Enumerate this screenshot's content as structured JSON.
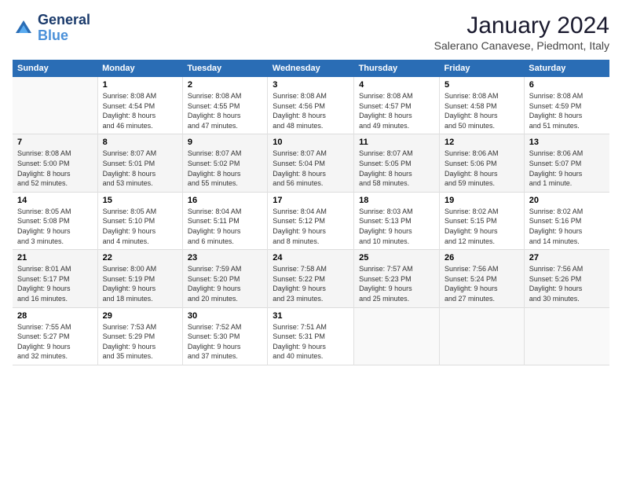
{
  "logo": {
    "line1": "General",
    "line2": "Blue"
  },
  "title": "January 2024",
  "location": "Salerano Canavese, Piedmont, Italy",
  "days_header": [
    "Sunday",
    "Monday",
    "Tuesday",
    "Wednesday",
    "Thursday",
    "Friday",
    "Saturday"
  ],
  "weeks": [
    [
      {
        "num": "",
        "info": ""
      },
      {
        "num": "1",
        "info": "Sunrise: 8:08 AM\nSunset: 4:54 PM\nDaylight: 8 hours\nand 46 minutes."
      },
      {
        "num": "2",
        "info": "Sunrise: 8:08 AM\nSunset: 4:55 PM\nDaylight: 8 hours\nand 47 minutes."
      },
      {
        "num": "3",
        "info": "Sunrise: 8:08 AM\nSunset: 4:56 PM\nDaylight: 8 hours\nand 48 minutes."
      },
      {
        "num": "4",
        "info": "Sunrise: 8:08 AM\nSunset: 4:57 PM\nDaylight: 8 hours\nand 49 minutes."
      },
      {
        "num": "5",
        "info": "Sunrise: 8:08 AM\nSunset: 4:58 PM\nDaylight: 8 hours\nand 50 minutes."
      },
      {
        "num": "6",
        "info": "Sunrise: 8:08 AM\nSunset: 4:59 PM\nDaylight: 8 hours\nand 51 minutes."
      }
    ],
    [
      {
        "num": "7",
        "info": "Sunrise: 8:08 AM\nSunset: 5:00 PM\nDaylight: 8 hours\nand 52 minutes."
      },
      {
        "num": "8",
        "info": "Sunrise: 8:07 AM\nSunset: 5:01 PM\nDaylight: 8 hours\nand 53 minutes."
      },
      {
        "num": "9",
        "info": "Sunrise: 8:07 AM\nSunset: 5:02 PM\nDaylight: 8 hours\nand 55 minutes."
      },
      {
        "num": "10",
        "info": "Sunrise: 8:07 AM\nSunset: 5:04 PM\nDaylight: 8 hours\nand 56 minutes."
      },
      {
        "num": "11",
        "info": "Sunrise: 8:07 AM\nSunset: 5:05 PM\nDaylight: 8 hours\nand 58 minutes."
      },
      {
        "num": "12",
        "info": "Sunrise: 8:06 AM\nSunset: 5:06 PM\nDaylight: 8 hours\nand 59 minutes."
      },
      {
        "num": "13",
        "info": "Sunrise: 8:06 AM\nSunset: 5:07 PM\nDaylight: 9 hours\nand 1 minute."
      }
    ],
    [
      {
        "num": "14",
        "info": "Sunrise: 8:05 AM\nSunset: 5:08 PM\nDaylight: 9 hours\nand 3 minutes."
      },
      {
        "num": "15",
        "info": "Sunrise: 8:05 AM\nSunset: 5:10 PM\nDaylight: 9 hours\nand 4 minutes."
      },
      {
        "num": "16",
        "info": "Sunrise: 8:04 AM\nSunset: 5:11 PM\nDaylight: 9 hours\nand 6 minutes."
      },
      {
        "num": "17",
        "info": "Sunrise: 8:04 AM\nSunset: 5:12 PM\nDaylight: 9 hours\nand 8 minutes."
      },
      {
        "num": "18",
        "info": "Sunrise: 8:03 AM\nSunset: 5:13 PM\nDaylight: 9 hours\nand 10 minutes."
      },
      {
        "num": "19",
        "info": "Sunrise: 8:02 AM\nSunset: 5:15 PM\nDaylight: 9 hours\nand 12 minutes."
      },
      {
        "num": "20",
        "info": "Sunrise: 8:02 AM\nSunset: 5:16 PM\nDaylight: 9 hours\nand 14 minutes."
      }
    ],
    [
      {
        "num": "21",
        "info": "Sunrise: 8:01 AM\nSunset: 5:17 PM\nDaylight: 9 hours\nand 16 minutes."
      },
      {
        "num": "22",
        "info": "Sunrise: 8:00 AM\nSunset: 5:19 PM\nDaylight: 9 hours\nand 18 minutes."
      },
      {
        "num": "23",
        "info": "Sunrise: 7:59 AM\nSunset: 5:20 PM\nDaylight: 9 hours\nand 20 minutes."
      },
      {
        "num": "24",
        "info": "Sunrise: 7:58 AM\nSunset: 5:22 PM\nDaylight: 9 hours\nand 23 minutes."
      },
      {
        "num": "25",
        "info": "Sunrise: 7:57 AM\nSunset: 5:23 PM\nDaylight: 9 hours\nand 25 minutes."
      },
      {
        "num": "26",
        "info": "Sunrise: 7:56 AM\nSunset: 5:24 PM\nDaylight: 9 hours\nand 27 minutes."
      },
      {
        "num": "27",
        "info": "Sunrise: 7:56 AM\nSunset: 5:26 PM\nDaylight: 9 hours\nand 30 minutes."
      }
    ],
    [
      {
        "num": "28",
        "info": "Sunrise: 7:55 AM\nSunset: 5:27 PM\nDaylight: 9 hours\nand 32 minutes."
      },
      {
        "num": "29",
        "info": "Sunrise: 7:53 AM\nSunset: 5:29 PM\nDaylight: 9 hours\nand 35 minutes."
      },
      {
        "num": "30",
        "info": "Sunrise: 7:52 AM\nSunset: 5:30 PM\nDaylight: 9 hours\nand 37 minutes."
      },
      {
        "num": "31",
        "info": "Sunrise: 7:51 AM\nSunset: 5:31 PM\nDaylight: 9 hours\nand 40 minutes."
      },
      {
        "num": "",
        "info": ""
      },
      {
        "num": "",
        "info": ""
      },
      {
        "num": "",
        "info": ""
      }
    ]
  ]
}
